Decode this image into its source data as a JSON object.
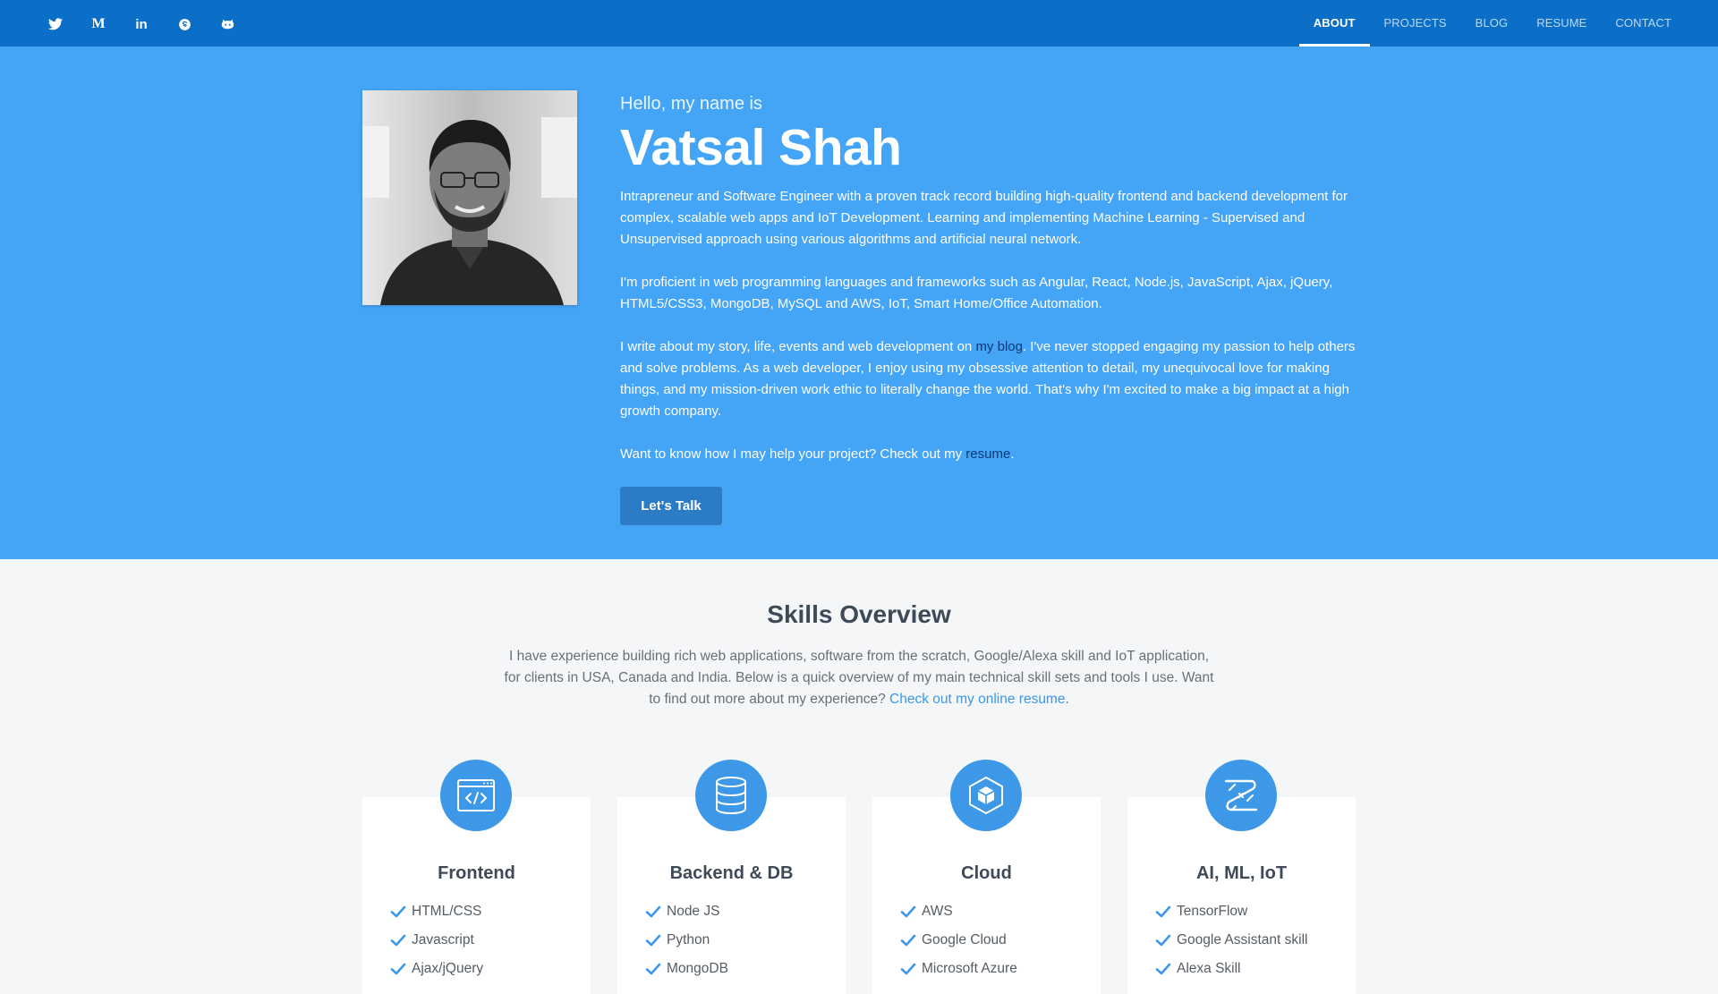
{
  "social": [
    {
      "name": "twitter-icon"
    },
    {
      "name": "medium-icon",
      "text": "M"
    },
    {
      "name": "linkedin-icon",
      "text": "in"
    },
    {
      "name": "skype-icon"
    },
    {
      "name": "github-icon"
    }
  ],
  "nav": {
    "items": [
      "ABOUT",
      "PROJECTS",
      "BLOG",
      "RESUME",
      "CONTACT"
    ],
    "active": "ABOUT"
  },
  "hero": {
    "greeting": "Hello, my name is",
    "name": "Vatsal Shah",
    "p1": "Intrapreneur and Software Engineer with a proven track record building high-quality frontend and backend development for complex, scalable web apps and IoT Development. Learning and implementing Machine Learning - Supervised and Unsupervised approach using various algorithms and artificial neural network.",
    "p2": "I'm proficient in web programming languages and frameworks such as Angular, React, Node.js, JavaScript, Ajax, jQuery, HTML5/CSS3, MongoDB, MySQL and AWS, IoT, Smart Home/Office Automation.",
    "p3_before": "I write about my story, life, events and web development on ",
    "p3_link": "my blog",
    "p3_after": ". I've never stopped engaging my passion to help others and solve problems. As a web developer, I enjoy using my obsessive attention to detail, my unequivocal love for making things, and my mission-driven work ethic to literally change the world. That's why I'm excited to make a big impact at a high growth company.",
    "p4_before": "Want to know how I may help your project? Check out my ",
    "p4_link": "resume",
    "p4_after": ".",
    "button": "Let's Talk"
  },
  "skills": {
    "title": "Skills Overview",
    "intro_before": "I have experience building rich web applications, software from the scratch, Google/Alexa skill and IoT application, for clients in USA, Canada and India. Below is a quick overview of my main technical skill sets and tools I use. Want to find out more about my experience? ",
    "intro_link": "Check out my online resume",
    "intro_after": ".",
    "cards": [
      {
        "title": "Frontend",
        "icon": "code-window-icon",
        "items": [
          "HTML/CSS",
          "Javascript",
          "Ajax/jQuery"
        ]
      },
      {
        "title": "Backend & DB",
        "icon": "database-icon",
        "items": [
          "Node JS",
          "Python",
          "MongoDB"
        ]
      },
      {
        "title": "Cloud",
        "icon": "cube-icon",
        "items": [
          "AWS",
          "Google Cloud",
          "Microsoft Azure"
        ]
      },
      {
        "title": "AI, ML, IoT",
        "icon": "circuit-icon",
        "items": [
          "TensorFlow",
          "Google Assistant skill",
          "Alexa Skill"
        ]
      }
    ]
  },
  "colors": {
    "navbar": "#0b6fc7",
    "hero": "#44a4f5",
    "accent": "#3d98e8",
    "button": "#2b7cc4"
  }
}
